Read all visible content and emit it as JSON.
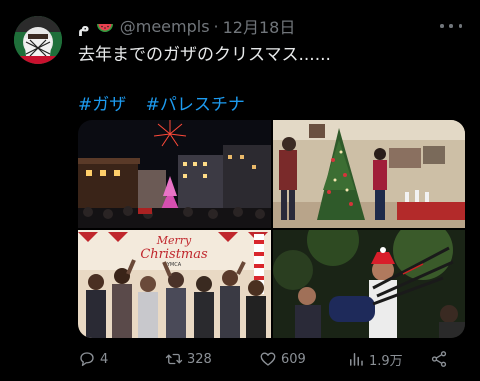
{
  "tweet": {
    "display_name": "م",
    "name_emoji": "watermelon-emoji",
    "handle": "@meempls",
    "separator": "·",
    "date": "12月18日",
    "text": "去年までのガザのクリスマス......",
    "hashtags": [
      "#ガザ",
      "#パレスチナ"
    ]
  },
  "media": {
    "images": [
      {
        "description_icon": "fireworks-photo"
      },
      {
        "description_icon": "christmas-tree-photo"
      },
      {
        "description_icon": "crowd-photo",
        "sign_text_1": "Merry",
        "sign_text_2": "Christmas",
        "sign_text_3": "YMCA"
      },
      {
        "description_icon": "bagpipe-photo"
      }
    ]
  },
  "actions": {
    "replies": "4",
    "retweets": "328",
    "likes": "609",
    "views": "1.9万"
  },
  "colors": {
    "background": "#000000",
    "text": "#e7e9ea",
    "secondary": "#71767b",
    "link": "#1d9bf0"
  }
}
